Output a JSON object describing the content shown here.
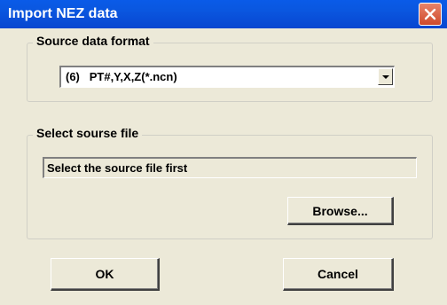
{
  "window": {
    "title": "Import NEZ data"
  },
  "source_format": {
    "group_label": "Source data format",
    "selected": "(6)   PT#,Y,X,Z(*.ncn)"
  },
  "source_file": {
    "group_label": "Select sourse file",
    "path_value": "Select the source file first",
    "browse_label": "Browse..."
  },
  "buttons": {
    "ok_label": "OK",
    "cancel_label": "Cancel"
  },
  "icons": {
    "close": "close-icon",
    "dropdown": "chevron-down-icon"
  },
  "colors": {
    "titlebar": "#0a5be8",
    "dialog_bg": "#ece9d8",
    "close_button": "#cf4a2c"
  }
}
